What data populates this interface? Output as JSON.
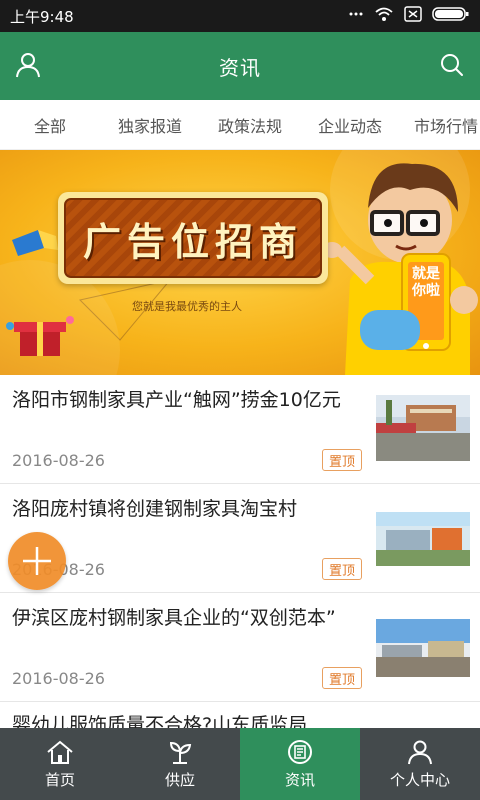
{
  "status_bar": {
    "time": "上午9:48"
  },
  "header": {
    "title": "资讯"
  },
  "tabs": [
    "全部",
    "独家报道",
    "政策法规",
    "企业动态",
    "市场行情"
  ],
  "banner": {
    "headline": "广告位招商",
    "tagline": "您就是我最优秀的主人",
    "phone_text": "就是你啦"
  },
  "news": [
    {
      "title": "洛阳市钢制家具产业“触网”捞金10亿元",
      "date": "2016-08-26",
      "badge": "置顶"
    },
    {
      "title": "洛阳庞村镇将创建钢制家具淘宝村",
      "date": "2016-08-26",
      "badge": "置顶"
    },
    {
      "title": "伊滨区庞村钢制家具企业的“双创范本”",
      "date": "2016-08-26",
      "badge": "置顶"
    },
    {
      "title": "婴幼儿服饰质量不合格?山东质监局"
    }
  ],
  "bottom_nav": [
    {
      "label": "首页",
      "icon": "home-icon"
    },
    {
      "label": "供应",
      "icon": "plant-icon"
    },
    {
      "label": "资讯",
      "icon": "news-icon",
      "active": true
    },
    {
      "label": "个人中心",
      "icon": "user-icon"
    }
  ],
  "colors": {
    "primary": "#2f8f5c",
    "nav_bg": "#444a4c",
    "badge": "#e07a2a",
    "fab": "#f08c28"
  }
}
